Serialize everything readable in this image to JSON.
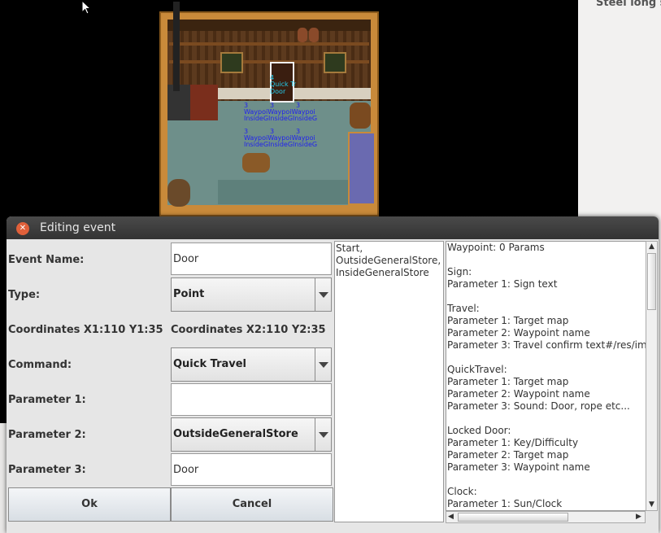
{
  "background": {
    "right_panel_text": "Steel long s"
  },
  "map": {
    "door_event_label_1": "4",
    "door_event_label_2": "Quick Tr",
    "door_event_label_3": "Door",
    "waypoint_rows": [
      {
        "num": [
          "3",
          "3",
          "3"
        ],
        "a": "WaypoiWaypoiWaypoi",
        "b": "InsideGInsideGInsideG"
      },
      {
        "num": [
          "3",
          "3",
          "3"
        ],
        "a": "WaypoiWaypoiWaypoi",
        "b": "InsideGInsideGInsideG"
      }
    ]
  },
  "dialog": {
    "title": "Editing event",
    "labels": {
      "event_name": "Event Name:",
      "type": "Type:",
      "coords1": "Coordinates X1:110 Y1:35",
      "coords2": "Coordinates X2:110 Y2:35",
      "command": "Command:",
      "param1": "Parameter 1:",
      "param2": "Parameter 2:",
      "param3": "Parameter 3:"
    },
    "values": {
      "event_name": "Door",
      "type": "Point",
      "command": "Quick Travel",
      "param1": "",
      "param2": "OutsideGeneralStore",
      "param3": "Door"
    },
    "buttons": {
      "ok": "Ok",
      "cancel": "Cancel"
    },
    "maps_list": [
      "Start,",
      "OutsideGeneralStore,",
      "InsideGeneralStore"
    ],
    "help_lines": [
      "Waypoint: 0 Params",
      "",
      "Sign:",
      "Parameter 1: Sign text",
      "",
      "Travel:",
      "Parameter 1: Target map",
      "Parameter 2: Waypoint name",
      "Parameter 3: Travel confirm text#/res/im",
      "",
      "QuickTravel:",
      "Parameter 1: Target map",
      "Parameter 2: Waypoint name",
      "Parameter 3: Sound: Door, rope etc...",
      "",
      "Locked Door:",
      "Parameter 1: Key/Difficulty",
      "Parameter 2: Target map",
      "Parameter 3: Waypoint name",
      "",
      "Clock:",
      "Parameter 1: Sun/Clock"
    ]
  }
}
